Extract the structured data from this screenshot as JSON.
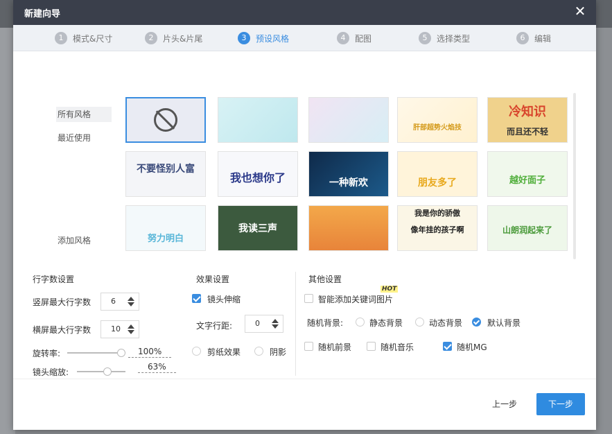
{
  "dialog": {
    "title": "新建向导"
  },
  "steps": [
    {
      "num": "1",
      "label": "模式&尺寸"
    },
    {
      "num": "2",
      "label": "片头&片尾"
    },
    {
      "num": "3",
      "label": "预设风格"
    },
    {
      "num": "4",
      "label": "配图"
    },
    {
      "num": "5",
      "label": "选择类型"
    },
    {
      "num": "6",
      "label": "编辑"
    }
  ],
  "categories": {
    "all": "所有风格",
    "recent": "最近使用",
    "add": "添加风格"
  },
  "thumbnails": {
    "t2": "不要怪别人富",
    "t3": "我也想你了",
    "t4": "一种新欢",
    "t5": "朋友多了",
    "t6": "越好面子",
    "t7": "我读三声",
    "t8": "我是你的骄傲",
    "t9": "像年挂的孩子啊",
    "t10": "山朗润起来了",
    "t11": "冷知识",
    "t12": "而且还不轻",
    "t13": "努力明白",
    "t14": "肝部超势火焰技"
  },
  "settings": {
    "lines_title": "行字数设置",
    "vertical_max_label": "竖屏最大行字数",
    "vertical_max_value": "6",
    "horizontal_max_label": "横屏最大行字数",
    "horizontal_max_value": "10",
    "rotation_label": "旋转率:",
    "rotation_value": "100%",
    "zoom_label": "镜头缩放:",
    "zoom_value": "63%",
    "effects_title": "效果设置",
    "lens_zoom": "镜头伸缩",
    "line_spacing_label": "文字行距:",
    "line_spacing_value": "0",
    "paper_cut": "剪纸效果",
    "shadow": "阴影",
    "other_title": "其他设置",
    "hot_badge": "HOT",
    "smart_keyword": "智能添加关键词图片",
    "random_bg_label": "随机背景:",
    "bg_dynamic": "静态背景",
    "bg_animated": "动态背景",
    "bg_default": "默认背景",
    "random_fg": "随机前景",
    "random_music": "随机音乐",
    "random_mg": "随机MG"
  },
  "footer": {
    "prev": "上一步",
    "next": "下一步"
  },
  "colors": {
    "accent": "#2f8be0",
    "titlebar": "#3a3f4b"
  }
}
